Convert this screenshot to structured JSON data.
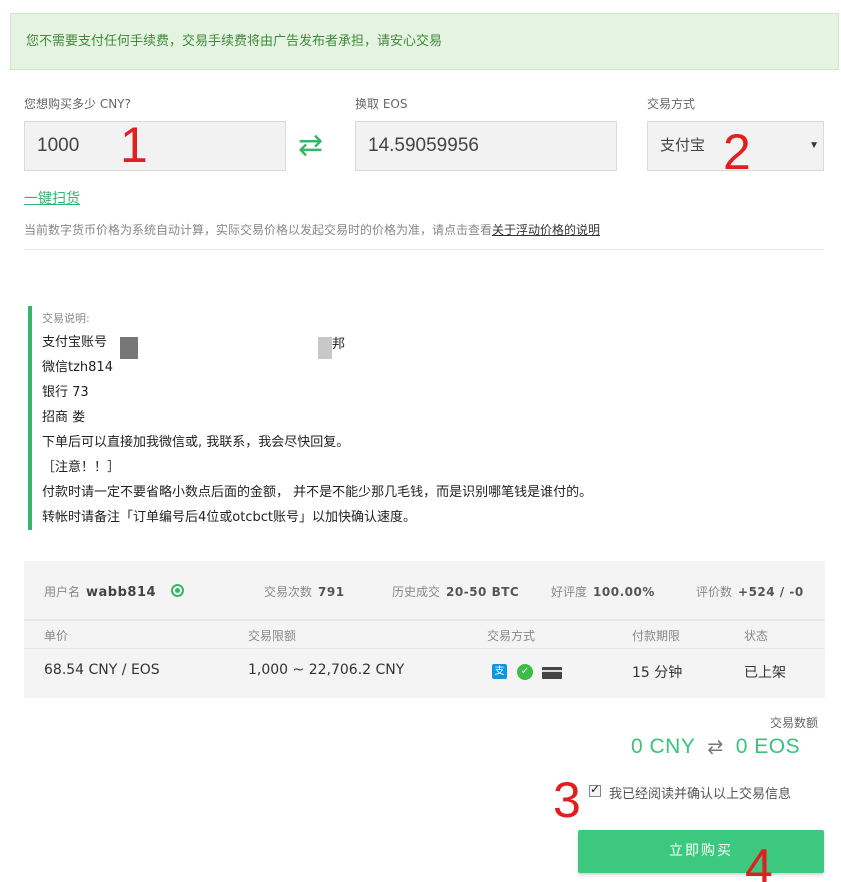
{
  "notice": "您不需要支付任何手续费，交易手续费将由广告发布者承担，请安心交易",
  "form": {
    "cny_label": "您想购买多少 CNY?",
    "cny_value": "1000",
    "eos_label": "换取 EOS",
    "eos_value": "14.59059956",
    "method_label": "交易方式",
    "method_value": "支付宝",
    "sweep_link": "一键扫货",
    "tip_text": "当前数字货币价格为系统自动计算，实际交易价格以发起交易时的价格为准，请点击查看",
    "tip_link": "关于浮动价格的说明"
  },
  "markers": [
    "1",
    "2",
    "3",
    "4"
  ],
  "description": {
    "title": "交易说明:",
    "lines": [
      "支付宝账号",
      "微信tzh814",
      "银行                                    73",
      "招商                                   娄",
      "下单后可以直接加我微信或,          我联系，我会尽快回复。",
      "［注意！！］",
      "付款时请一定不要省略小数点后面的金额，  并不是不能少那几毛钱，而是识别哪笔钱是谁付的。",
      "转帐时请备注「订单编号后4位或otcbct账号」以加快确认速度。"
    ],
    "suffix_line1": "邦"
  },
  "seller": {
    "username_label": "用户名",
    "username": "wabb814",
    "trades_label": "交易次数",
    "trades": "791",
    "history_label": "历史成交",
    "history": "20-50 BTC",
    "rating_label": "好评度",
    "rating": "100.00%",
    "reviews_label": "评价数",
    "reviews": "+524 / -0"
  },
  "table": {
    "headers": [
      "单价",
      "交易限额",
      "交易方式",
      "付款期限",
      "状态"
    ],
    "row": [
      "68.54 CNY / EOS",
      "1,000 ~ 22,706.2 CNY",
      "",
      "15 分钟",
      "已上架"
    ]
  },
  "pay_icons": [
    "alipay-icon",
    "wechat-icon",
    "bank-card-icon"
  ],
  "summary": {
    "label": "交易数额",
    "cny": "0 CNY",
    "arrow": "⇄",
    "eos": "0 EOS"
  },
  "agree_text": "我已经阅读并确认以上交易信息",
  "agree_checked": true,
  "buy_button": "立即购买",
  "colors": {
    "accent": "#3cc97f",
    "marker": "#e02020",
    "notice_bg": "#e5f3e1"
  }
}
